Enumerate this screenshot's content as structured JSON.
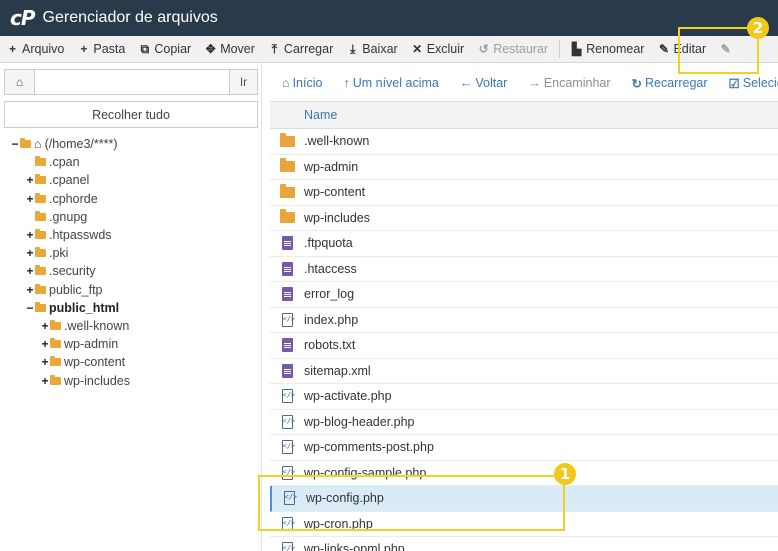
{
  "app": {
    "logo": "cP",
    "title": "Gerenciador de arquivos"
  },
  "toolbar": [
    {
      "icon": "+",
      "label": "Arquivo",
      "enabled": true
    },
    {
      "icon": "+",
      "label": "Pasta",
      "enabled": true
    },
    {
      "icon": "⧉",
      "label": "Copiar",
      "enabled": true
    },
    {
      "icon": "✥",
      "label": "Mover",
      "enabled": true
    },
    {
      "icon": "⤒",
      "label": "Carregar",
      "enabled": true
    },
    {
      "icon": "⤓",
      "label": "Baixar",
      "enabled": true
    },
    {
      "icon": "✕",
      "label": "Excluir",
      "enabled": true
    },
    {
      "icon": "↺",
      "label": "Restaurar",
      "enabled": false
    },
    {
      "icon": "▙",
      "label": "Renomear",
      "enabled": true
    },
    {
      "icon": "✎",
      "label": "Editar",
      "enabled": true
    },
    {
      "icon": "✎",
      "label": "",
      "enabled": false
    }
  ],
  "left": {
    "home_icon": "⌂",
    "path_value": "",
    "go_label": "Ir",
    "collapse_label": "Recolher tudo",
    "tree": [
      {
        "toggle": "−",
        "label": "(/home3/****)",
        "depth": 0,
        "bold": false,
        "root": true
      },
      {
        "toggle": "",
        "label": ".cpan",
        "depth": 1,
        "bold": false
      },
      {
        "toggle": "+",
        "label": ".cpanel",
        "depth": 1,
        "bold": false
      },
      {
        "toggle": "+",
        "label": ".cphorde",
        "depth": 1,
        "bold": false
      },
      {
        "toggle": "",
        "label": ".gnupg",
        "depth": 1,
        "bold": false
      },
      {
        "toggle": "+",
        "label": ".htpasswds",
        "depth": 1,
        "bold": false
      },
      {
        "toggle": "+",
        "label": ".pki",
        "depth": 1,
        "bold": false
      },
      {
        "toggle": "+",
        "label": ".security",
        "depth": 1,
        "bold": false
      },
      {
        "toggle": "+",
        "label": "public_ftp",
        "depth": 1,
        "bold": false
      },
      {
        "toggle": "−",
        "label": "public_html",
        "depth": 1,
        "bold": true
      },
      {
        "toggle": "+",
        "label": ".well-known",
        "depth": 2,
        "bold": false
      },
      {
        "toggle": "+",
        "label": "wp-admin",
        "depth": 2,
        "bold": false
      },
      {
        "toggle": "+",
        "label": "wp-content",
        "depth": 2,
        "bold": false
      },
      {
        "toggle": "+",
        "label": "wp-includes",
        "depth": 2,
        "bold": false
      }
    ]
  },
  "nav": [
    {
      "icon": "⌂",
      "label": "Início",
      "enabled": true
    },
    {
      "icon": "↑",
      "label": "Um nível acima",
      "enabled": true
    },
    {
      "icon": "←",
      "label": "Voltar",
      "enabled": true
    },
    {
      "icon": "→",
      "label": "Encaminhar",
      "enabled": false
    },
    {
      "icon": "↻",
      "label": "Recarregar",
      "enabled": true
    },
    {
      "icon": "☑",
      "label": "Selecionar",
      "enabled": true
    }
  ],
  "files": {
    "header_name": "Name",
    "rows": [
      {
        "type": "folder",
        "name": ".well-known"
      },
      {
        "type": "folder",
        "name": "wp-admin"
      },
      {
        "type": "folder",
        "name": "wp-content"
      },
      {
        "type": "folder",
        "name": "wp-includes"
      },
      {
        "type": "text",
        "name": ".ftpquota"
      },
      {
        "type": "text",
        "name": ".htaccess"
      },
      {
        "type": "text",
        "name": "error_log"
      },
      {
        "type": "code",
        "name": "index.php"
      },
      {
        "type": "text",
        "name": "robots.txt"
      },
      {
        "type": "text",
        "name": "sitemap.xml"
      },
      {
        "type": "code",
        "name": "wp-activate.php"
      },
      {
        "type": "code",
        "name": "wp-blog-header.php"
      },
      {
        "type": "code",
        "name": "wp-comments-post.php"
      },
      {
        "type": "code",
        "name": "wp-config-sample.php"
      },
      {
        "type": "code",
        "name": "wp-config.php",
        "selected": true
      },
      {
        "type": "code",
        "name": "wp-cron.php"
      },
      {
        "type": "code",
        "name": "wp-links-opml.php"
      }
    ]
  },
  "annotations": [
    {
      "number": "1",
      "color": "#f2d024"
    },
    {
      "number": "2",
      "color": "#f2d024"
    }
  ]
}
